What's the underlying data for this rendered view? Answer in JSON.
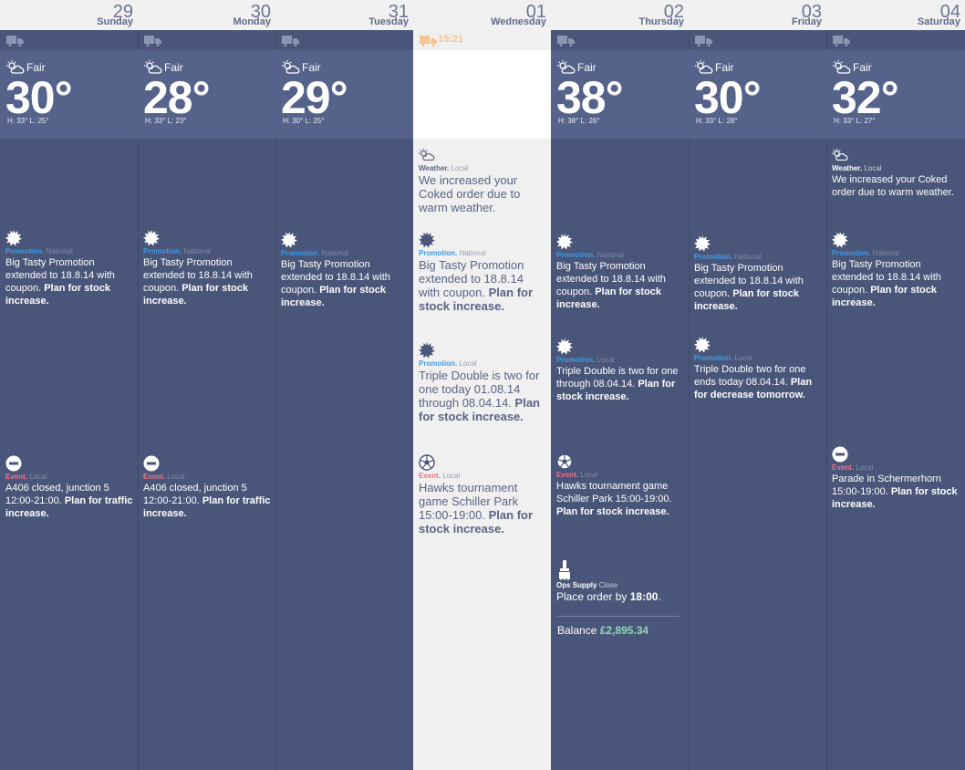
{
  "days": [
    {
      "num": "29",
      "name": "Sunday",
      "weather": {
        "cond": "Fair",
        "temp": "30°",
        "hl": "H: 33° L: 25°"
      },
      "cards": [
        {
          "icon": "promo",
          "type": "Promotion.",
          "scope": "National",
          "text": "Big Tasty Promotion extended to 18.8.14 with coupon.",
          "bold": "Plan for stock increase."
        },
        {
          "icon": "event",
          "type": "Event.",
          "scope": "Local",
          "text": "A406 closed, junction 5 12:00-21:00.",
          "bold": "Plan for traffic increase."
        }
      ]
    },
    {
      "num": "30",
      "name": "Monday",
      "weather": {
        "cond": "Fair",
        "temp": "28°",
        "hl": "H: 33° L: 23°"
      },
      "cards": [
        {
          "icon": "promo",
          "type": "Promotion.",
          "scope": "National",
          "text": "Big Tasty Promotion extended to 18.8.14 with coupon.",
          "bold": "Plan for stock increase."
        },
        {
          "icon": "event",
          "type": "Event.",
          "scope": "Local",
          "text": "A406 closed, junction 5 12:00-21:00.",
          "bold": "Plan for traffic increase."
        }
      ]
    },
    {
      "num": "31",
      "name": "Tuesday",
      "weather": {
        "cond": "Fair",
        "temp": "29°",
        "hl": "H: 30° L: 25°"
      },
      "cards": [
        {
          "icon": "promo",
          "type": "Promotion.",
          "scope": "National",
          "text": "Big Tasty Promotion extended to 18.8.14 with coupon.",
          "bold": "Plan for stock increase."
        }
      ]
    },
    {
      "num": "01",
      "name": "Wednesday",
      "time": "15:21",
      "cards": [
        {
          "icon": "weather",
          "type": "Weather.",
          "scope": "Local",
          "text": "We increased your Coked order due to warm weather.",
          "bold": ""
        },
        {
          "icon": "promo",
          "type": "Promotion.",
          "scope": "National",
          "text": "Big Tasty Promotion extended to 18.8.14 with coupon.",
          "bold": "Plan for stock increase."
        },
        {
          "icon": "promo",
          "type": "Promotion.",
          "scope": "Local",
          "text": "Triple Double is two for one today 01.08.14 through 08.04.14.",
          "bold": "Plan for stock increase."
        },
        {
          "icon": "ball",
          "type": "Event.",
          "scope": "Local",
          "text": "Hawks tournament game Schiller Park 15:00-19:00.",
          "bold": "Plan for stock increase."
        }
      ]
    },
    {
      "num": "02",
      "name": "Thursday",
      "weather": {
        "cond": "Fair",
        "temp": "38°",
        "hl": "H: 38° L: 26°"
      },
      "cards": [
        {
          "icon": "promo",
          "type": "Promotion.",
          "scope": "National",
          "text": "Big Tasty Promotion extended to 18.8.14 with coupon.",
          "bold": "Plan for stock increase."
        },
        {
          "icon": "promo",
          "type": "Promotion.",
          "scope": "Local",
          "text": "Triple Double is two for one through 08.04.14.",
          "bold": "Plan for stock increase."
        },
        {
          "icon": "ball",
          "type": "Event.",
          "scope": "Local",
          "text": "Hawks tournament game Schiller Park 15:00-19:00.",
          "bold": "Plan for stock increase."
        },
        {
          "icon": "brush",
          "type": "Ops Supply",
          "scope": "Close",
          "text": "Place order by",
          "bold": "18:00",
          "tail": "."
        }
      ],
      "balance": {
        "label": "Balance",
        "amount": "£2,895.34"
      }
    },
    {
      "num": "03",
      "name": "Friday",
      "weather": {
        "cond": "Fair",
        "temp": "30°",
        "hl": "H: 33° L: 28°"
      },
      "cards": [
        {
          "icon": "promo",
          "type": "Promotion.",
          "scope": "National",
          "text": "Big Tasty Promotion extended to 18.8.14 with coupon.",
          "bold": "Plan for stock increase."
        },
        {
          "icon": "promo",
          "type": "Promotion.",
          "scope": "Local",
          "text": "Triple Double two for one ends today 08.04.14.",
          "bold": "Plan for decrease tomorrow."
        }
      ]
    },
    {
      "num": "04",
      "name": "Saturday",
      "weather": {
        "cond": "Fair",
        "temp": "32°",
        "hl": "H: 33° L: 27°"
      },
      "cards": [
        {
          "icon": "weather",
          "type": "Weather.",
          "scope": "Local",
          "text": "We increased your Coked order due to warm weather.",
          "bold": ""
        },
        {
          "icon": "promo",
          "type": "Promotion.",
          "scope": "National",
          "text": "Big Tasty Promotion extended to 18.8.14 with coupon.",
          "bold": "Plan for stock increase."
        },
        {
          "icon": "event",
          "type": "Event.",
          "scope": "Local",
          "text": "Parade in Schermerhorn 15:00-19:00.",
          "bold": "Plan for stock increase."
        }
      ]
    }
  ],
  "colors": {
    "column": "#4a5679",
    "weather": "#55628a",
    "today": "#f0f0f0",
    "promo": "#3d9be6",
    "event": "#e8738a",
    "balance": "#8fd9b6",
    "truck_today": "#f7c58f"
  }
}
